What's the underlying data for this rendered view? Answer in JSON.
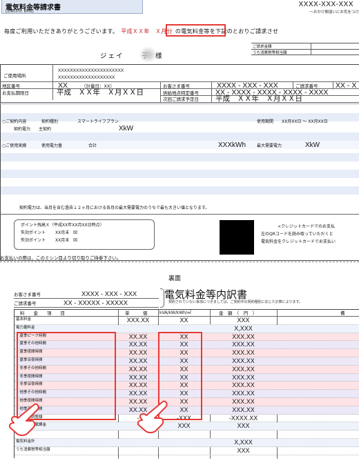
{
  "header": {
    "title": "電気料金等請求書",
    "subtitle": "[Electric bills]",
    "phone": "XXXX-XXX-XXX",
    "phone_note": "～おかけ間違いにお気をつけ"
  },
  "greeting": {
    "prefix": "毎度ご利用いただきありがとうございます。",
    "period": "平成ＸＸ年　Ｘ月分",
    "suffix": "の電気料金等を下記のとおりご請求させ"
  },
  "summary_box": {
    "label1": "ご請求金額",
    "label2": "うち消費税等相当額"
  },
  "customer": {
    "name_left": "ジェイ",
    "name_right": "子",
    "honorific": "様"
  },
  "usage": {
    "place_label": "ご使用場所",
    "address1": "XXXXXXXXXXXXXXXXXXXXXX",
    "address2": "XXXXXXXXXXXXXXXXXXX",
    "district_label": "地区番号",
    "district_val": "XX",
    "meter_day": "（計量日：XX）",
    "customer_no_label": "お客さま番号",
    "customer_no": "XXXX - XXX - XXX",
    "bill_no_label": "ご請求番号",
    "bill_no": "XX - X",
    "due_label": "お支払期限日",
    "due_val": "平成　ＸＸ年　Ｘ月ＸＸ日",
    "supply_label": "供給地点特定番号",
    "supply_no": "XX - XXXX - XXXX - XXXX - XXXX",
    "next_label": "次回ご請求予定日",
    "next_val": "平成　ＸＸ年　Ｘ月ＸＸ日"
  },
  "contract": {
    "line1_label": "○ご契約内容",
    "type_label": "契約種別",
    "plan": "スマートライフプラン",
    "period_label": "使用期間",
    "period_val": "XX月XX日 ～ XX月XX日",
    "power_label": "契約電力",
    "power_type": "主契約",
    "power_val": "XkW",
    "actual_label": "○ご使用実績",
    "usage_label": "使用電力量",
    "total_label": "合計",
    "total_val": "XXXkWh",
    "max_label": "最大需要電力",
    "max_val": "XkW"
  },
  "note": "契約電力は、当月を含む過去１２ヶ月における各月の最大需要電力のうちで最も大きい値となります。",
  "points": {
    "line1": "ポイント残高Ｘ（平成XX年XX月XX日時点）",
    "line2_label": "失効ポイント",
    "line2_val": "XX月末",
    "line3_label": "失効ポイント",
    "line3_val": "XX月末",
    "mark": "☒"
  },
  "card_text": {
    "l1": "<クレジットカードでのお支払",
    "l2": "左のQRコードを読み取っていただくと",
    "l3": "電気料金をクレジットカードでお支払い"
  },
  "tear_note": "お支払いの際は、このミシン目より切り取りご持参下さい。",
  "back_label": "裏面",
  "breakdown": {
    "customer_no_label": "お客さま番号",
    "customer_no": "XXXX - XXX - XXX",
    "bill_no_label": "ご請求番号",
    "bill_no": "XX - XXXXX - XXXXX",
    "title": "電気料金等内訳書",
    "note": "契約されていない事項につきましては、ご契約中の契約種別に応じた計算によります。",
    "col_item": "料　　金　　項　　目",
    "col_unit": "単　　　価",
    "col_qty": "kVA/kW/kWh/㎡",
    "col_amount": "金　額　（　円　）",
    "col_note": "備",
    "rows": [
      {
        "item": "基本料金",
        "unit": "XXX.XX",
        "qty": "XX",
        "amount": "XXX"
      },
      {
        "item": "電力量料金",
        "unit": "",
        "qty": "",
        "amount": "X,XXX"
      },
      {
        "item": "・夏季ピーク時間",
        "unit": "XX.XX",
        "qty": "XX",
        "amount": "XXX.XX"
      },
      {
        "item": "・夏季その他時間",
        "unit": "XX.XX",
        "qty": "XX",
        "amount": "XXX.XX"
      },
      {
        "item": "・夏季夜間時間",
        "unit": "XX.XX",
        "qty": "XX",
        "amount": "XXX.XX"
      },
      {
        "item": "・夏季深夜時間",
        "unit": "XX.XX",
        "qty": "XX",
        "amount": "XXX.XX"
      },
      {
        "item": "・冬季その他時間",
        "unit": "XX.XX",
        "qty": "XX",
        "amount": "XXX.XX"
      },
      {
        "item": "・冬季夜間時間",
        "unit": "XX.XX",
        "qty": "XX",
        "amount": "XXX.XX"
      },
      {
        "item": "・冬季深夜時間",
        "unit": "XX.XX",
        "qty": "XX",
        "amount": "XXX.XX"
      },
      {
        "item": "・他季その他時間",
        "unit": "XX.XX",
        "qty": "XX",
        "amount": "XXX.XX"
      },
      {
        "item": "・他季夜間時間",
        "unit": "XX.XX",
        "qty": "XX",
        "amount": "XXX.XX"
      },
      {
        "item": "・他季深夜時間",
        "unit": "XX.XX",
        "qty": "XX",
        "amount": "XXX.XX"
      },
      {
        "item": "・燃料費調整額",
        "unit": "-",
        "qty": "-XXX",
        "amount": "-XXXX.XX"
      },
      {
        "item": "再エネ発電賦課金",
        "unit": "",
        "qty": "XXX",
        "amount": "XXX"
      },
      {
        "item": "",
        "unit": "",
        "qty": "",
        "amount": ""
      },
      {
        "item": "電気料金計",
        "unit": "",
        "qty": "",
        "amount": "X,XXX"
      },
      {
        "item": "うち消費税等相当額",
        "unit": "",
        "qty": "",
        "amount": "XXX"
      }
    ]
  }
}
